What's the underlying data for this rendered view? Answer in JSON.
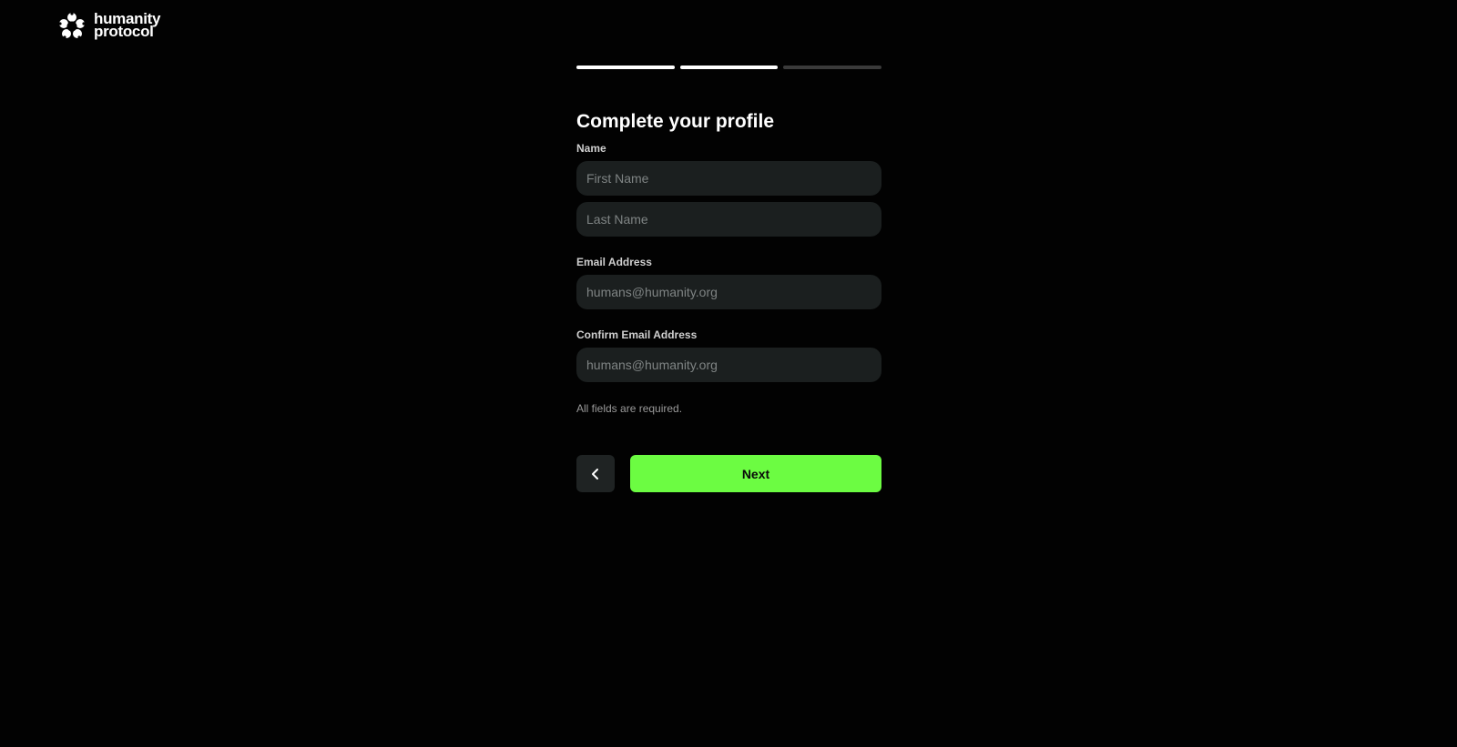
{
  "brand": {
    "line1": "humanity",
    "line2": "protocol",
    "logo_icon": "humanity-protocol-logo-icon"
  },
  "progress": {
    "total_steps": 3,
    "completed_steps": 2
  },
  "form": {
    "title": "Complete your profile",
    "name_label": "Name",
    "first_name_placeholder": "First Name",
    "last_name_placeholder": "Last Name",
    "email_label": "Email Address",
    "email_placeholder": "humans@humanity.org",
    "confirm_email_label": "Confirm Email Address",
    "confirm_email_placeholder": "humans@humanity.org",
    "hint": "All fields are required."
  },
  "actions": {
    "back_icon": "chevron-left-icon",
    "next_label": "Next"
  },
  "colors": {
    "background": "#020202",
    "input_bg": "#1b1f1f",
    "accent": "#6cfc42",
    "progress_done": "#ffffff",
    "progress_pending": "#3a3a3a"
  }
}
